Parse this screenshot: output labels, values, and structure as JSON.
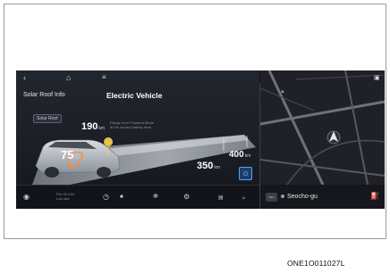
{
  "header": {
    "left_title": "Solar Roof Info",
    "main_title": "Electric Vehicle",
    "solar_tab": "Solar Roof"
  },
  "gauge": {
    "value": "75",
    "unit": "%"
  },
  "stats": {
    "d1_value": "190",
    "d1_unit": "km",
    "d1_note_line1": "Range from Powered Mode",
    "d1_note_line2": "at the current battery level",
    "d2_value": "350",
    "d2_unit": "km",
    "d3_value": "400",
    "d3_unit": "km"
  },
  "bottom_bar": {
    "time_line1": "Feb 05 4:02",
    "time_line2": "Low rate"
  },
  "map": {
    "place": "Seocho-gu",
    "chip_label": "Navi"
  },
  "caption": "ONE1O011027L",
  "colors": {
    "screen_bg": "#101218",
    "accent_blue": "#4fa6ff",
    "road": "#aeb4bd"
  }
}
